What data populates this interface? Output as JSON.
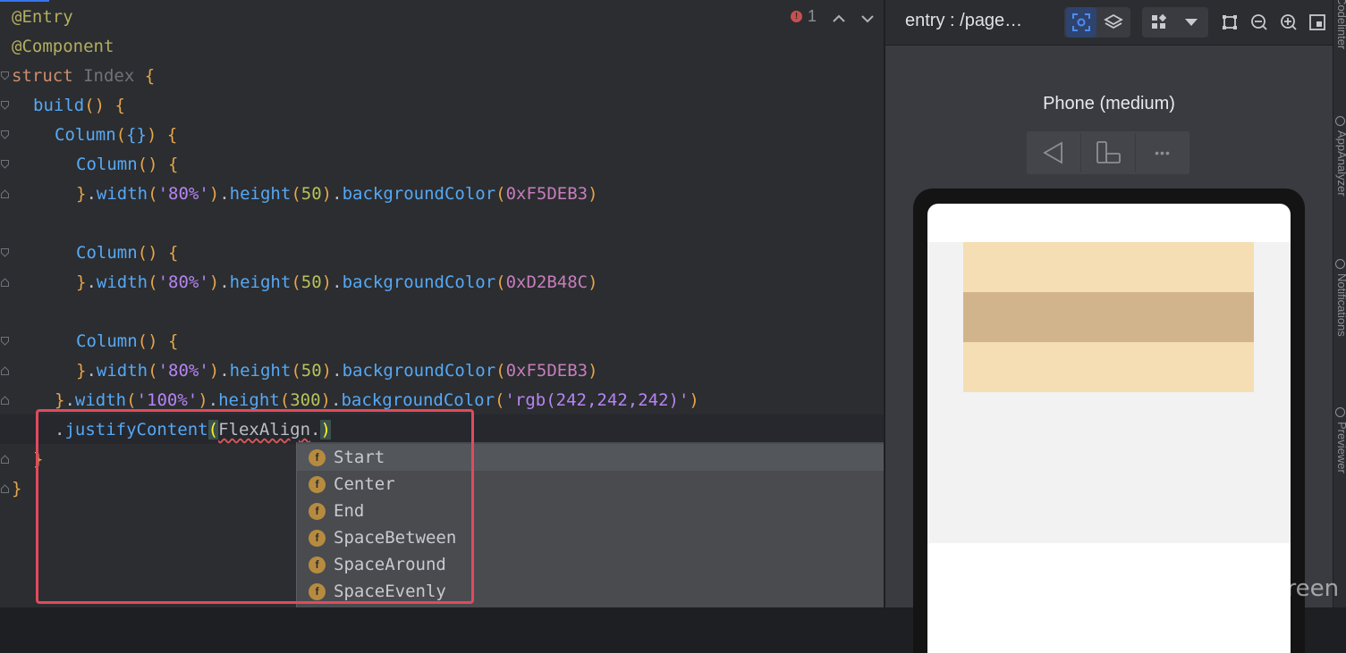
{
  "editor": {
    "inspection": {
      "error_count": "1",
      "error_glyph": "!"
    },
    "lines": [
      [
        "@Entry"
      ],
      [
        "@Component"
      ],
      [
        "struct",
        " ",
        "Index",
        " ",
        "{"
      ],
      [
        "build",
        "()",
        " ",
        "{"
      ],
      [
        "Column",
        "(",
        "{}",
        ")",
        " ",
        "{"
      ],
      [
        "Column",
        "()",
        " ",
        "{"
      ],
      [
        "}",
        ".",
        "width",
        "(",
        "'80%'",
        ")",
        ".",
        "height",
        "(",
        "50",
        ")",
        ".",
        "backgroundColor",
        "(",
        "0xF5DEB3",
        ")"
      ],
      [
        "Column",
        "()",
        " ",
        "{"
      ],
      [
        "}",
        ".",
        "width",
        "(",
        "'80%'",
        ")",
        ".",
        "height",
        "(",
        "50",
        ")",
        ".",
        "backgroundColor",
        "(",
        "0xD2B48C",
        ")"
      ],
      [
        "Column",
        "()",
        " ",
        "{"
      ],
      [
        "}",
        ".",
        "width",
        "(",
        "'80%'",
        ")",
        ".",
        "height",
        "(",
        "50",
        ")",
        ".",
        "backgroundColor",
        "(",
        "0xF5DEB3",
        ")"
      ],
      [
        "}",
        ".",
        "width",
        "(",
        "'100%'",
        ")",
        ".",
        "height",
        "(",
        "300",
        ")",
        ".",
        "backgroundColor",
        "(",
        "'rgb(242,242,242)'",
        ")"
      ],
      [
        ".",
        "justifyContent",
        "(",
        "FlexAlign",
        ".",
        ")"
      ],
      [
        "}"
      ],
      [
        "}"
      ]
    ]
  },
  "completion": {
    "icon_letter": "f",
    "items": [
      "Start",
      "Center",
      "End",
      "SpaceBetween",
      "SpaceAround",
      "SpaceEvenly"
    ],
    "selected_index": 0
  },
  "previewer": {
    "title": "entry : /page…",
    "device_label": "Phone (medium)",
    "more_glyph": "•••",
    "colors": {
      "outer_column": "#F2F2F2",
      "column_1": "#F5DEB3",
      "column_2": "#D2B48C",
      "column_3": "#F5DEB3"
    }
  },
  "sidebar": {
    "labels": [
      "Codelinter",
      "AppAnalyzer",
      "Notifications",
      "Previewer"
    ]
  },
  "watermark": "CSDN @长青evergreen",
  "icons": [
    "error-icon",
    "arrow-up-icon",
    "arrow-down-icon",
    "inspect-icon",
    "layers-icon",
    "components-icon",
    "dropdown-icon",
    "frame-icon",
    "zoom-out-icon",
    "zoom-in-icon",
    "fit-screen-icon",
    "back-icon",
    "rotate-icon",
    "more-icon"
  ]
}
